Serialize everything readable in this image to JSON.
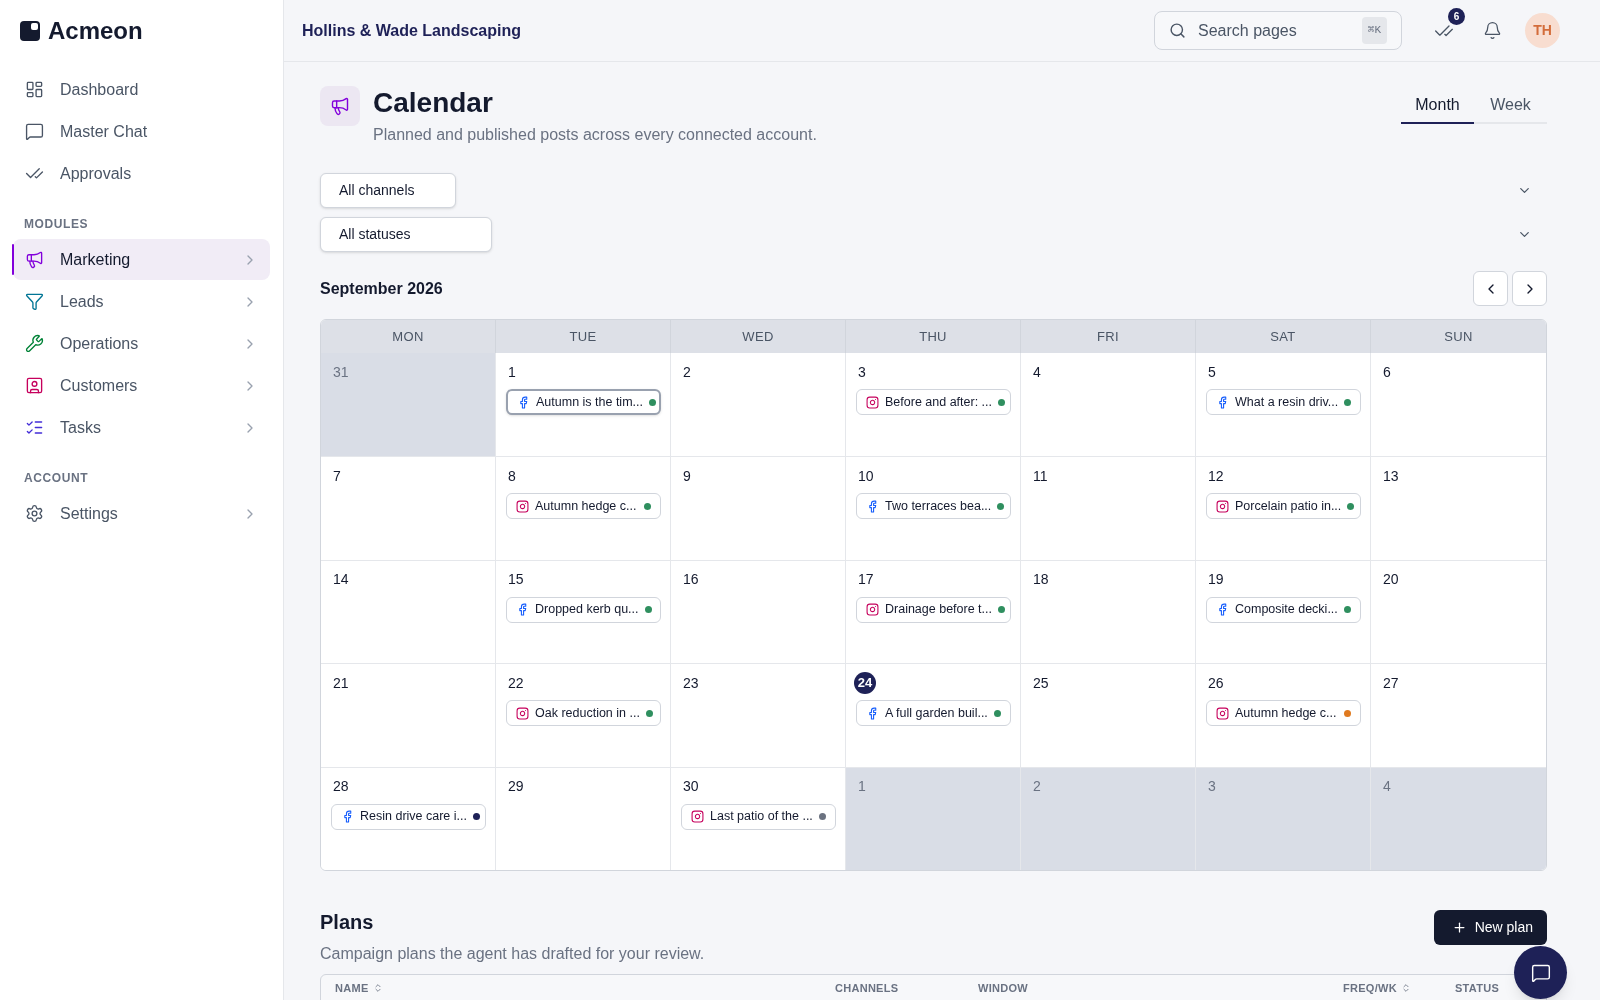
{
  "brand": "Acmeon",
  "sidebar": {
    "items": [
      {
        "label": "Dashboard",
        "selected": false,
        "expandable": false
      },
      {
        "label": "Master Chat",
        "selected": false,
        "expandable": false
      },
      {
        "label": "Approvals",
        "selected": false,
        "expandable": false
      }
    ],
    "sections": [
      {
        "heading": "MODULES",
        "items": [
          {
            "label": "Marketing",
            "selected": true,
            "expandable": true
          },
          {
            "label": "Leads",
            "selected": false,
            "expandable": true
          },
          {
            "label": "Operations",
            "selected": false,
            "expandable": true
          },
          {
            "label": "Customers",
            "selected": false,
            "expandable": true
          },
          {
            "label": "Tasks",
            "selected": false,
            "expandable": true
          }
        ]
      },
      {
        "heading": "ACCOUNT",
        "items": [
          {
            "label": "Settings",
            "selected": false,
            "expandable": true
          }
        ]
      }
    ]
  },
  "header": {
    "workspace": "Hollins & Wade Landscaping",
    "search": {
      "placeholder": "Search pages",
      "shortcut": "⌘K"
    },
    "approvals_badge": "6",
    "avatar": "TH"
  },
  "page": {
    "title": "Calendar",
    "subtitle": "Planned and published posts across every connected account."
  },
  "view_tabs": [
    {
      "label": "Month",
      "selected": true
    },
    {
      "label": "Week",
      "selected": false
    }
  ],
  "filters": [
    {
      "value": "All channels"
    },
    {
      "value": "All statuses"
    }
  ],
  "calendar": {
    "month": "September 2026",
    "weekdays": [
      "MON",
      "TUE",
      "WED",
      "THU",
      "FRI",
      "SAT",
      "SUN"
    ],
    "days": [
      {
        "date": "31",
        "outside": true,
        "today": false
      },
      {
        "date": "1",
        "outside": false,
        "today": false,
        "events": [
          {
            "kind": "facebook",
            "title": "Autumn is the tim...",
            "color": "#2f8f5f",
            "selected": true
          }
        ]
      },
      {
        "date": "2",
        "outside": false,
        "today": false
      },
      {
        "date": "3",
        "outside": false,
        "today": false,
        "events": [
          {
            "kind": "instagram",
            "title": "Before and after: ...",
            "color": "#2f8f5f",
            "selected": false
          }
        ]
      },
      {
        "date": "4",
        "outside": false,
        "today": false
      },
      {
        "date": "5",
        "outside": false,
        "today": false,
        "events": [
          {
            "kind": "facebook",
            "title": "What a resin driv...",
            "color": "#2f8f5f",
            "selected": false
          }
        ]
      },
      {
        "date": "6",
        "outside": false,
        "today": false
      },
      {
        "date": "7",
        "outside": false,
        "today": false
      },
      {
        "date": "8",
        "outside": false,
        "today": false,
        "events": [
          {
            "kind": "instagram",
            "title": "Autumn hedge c...",
            "color": "#2f8f5f",
            "selected": false
          }
        ]
      },
      {
        "date": "9",
        "outside": false,
        "today": false
      },
      {
        "date": "10",
        "outside": false,
        "today": false,
        "events": [
          {
            "kind": "facebook",
            "title": "Two terraces bea...",
            "color": "#2f8f5f",
            "selected": false
          }
        ]
      },
      {
        "date": "11",
        "outside": false,
        "today": false
      },
      {
        "date": "12",
        "outside": false,
        "today": false,
        "events": [
          {
            "kind": "instagram",
            "title": "Porcelain patio in...",
            "color": "#2f8f5f",
            "selected": false
          }
        ]
      },
      {
        "date": "13",
        "outside": false,
        "today": false
      },
      {
        "date": "14",
        "outside": false,
        "today": false
      },
      {
        "date": "15",
        "outside": false,
        "today": false,
        "events": [
          {
            "kind": "facebook",
            "title": "Dropped kerb qu...",
            "color": "#2f8f5f",
            "selected": false
          }
        ]
      },
      {
        "date": "16",
        "outside": false,
        "today": false
      },
      {
        "date": "17",
        "outside": false,
        "today": false,
        "events": [
          {
            "kind": "instagram",
            "title": "Drainage before t...",
            "color": "#2f8f5f",
            "selected": false
          }
        ]
      },
      {
        "date": "18",
        "outside": false,
        "today": false
      },
      {
        "date": "19",
        "outside": false,
        "today": false,
        "events": [
          {
            "kind": "facebook",
            "title": "Composite decki...",
            "color": "#2f8f5f",
            "selected": false
          }
        ]
      },
      {
        "date": "20",
        "outside": false,
        "today": false
      },
      {
        "date": "21",
        "outside": false,
        "today": false
      },
      {
        "date": "22",
        "outside": false,
        "today": false,
        "events": [
          {
            "kind": "instagram",
            "title": "Oak reduction in ...",
            "color": "#2f8f5f",
            "selected": false
          }
        ]
      },
      {
        "date": "23",
        "outside": false,
        "today": false
      },
      {
        "date": "24",
        "outside": false,
        "today": true,
        "events": [
          {
            "kind": "facebook",
            "title": "A full garden buil...",
            "color": "#2f8f5f",
            "selected": false
          }
        ]
      },
      {
        "date": "25",
        "outside": false,
        "today": false
      },
      {
        "date": "26",
        "outside": false,
        "today": false,
        "events": [
          {
            "kind": "instagram",
            "title": "Autumn hedge c...",
            "color": "#e07a1f",
            "selected": false
          }
        ]
      },
      {
        "date": "27",
        "outside": false,
        "today": false
      },
      {
        "date": "28",
        "outside": false,
        "today": false,
        "events": [
          {
            "kind": "facebook",
            "title": "Resin drive care i...",
            "color": "#1e2157",
            "selected": false
          }
        ]
      },
      {
        "date": "29",
        "outside": false,
        "today": false
      },
      {
        "date": "30",
        "outside": false,
        "today": false,
        "events": [
          {
            "kind": "instagram",
            "title": "Last patio of the ...",
            "color": "#6b7280",
            "selected": false
          }
        ]
      },
      {
        "date": "1",
        "outside": true,
        "today": false
      },
      {
        "date": "2",
        "outside": true,
        "today": false
      },
      {
        "date": "3",
        "outside": true,
        "today": false
      },
      {
        "date": "4",
        "outside": true,
        "today": false
      }
    ]
  },
  "plans": {
    "title": "Plans",
    "subtitle": "Campaign plans the agent has drafted for your review.",
    "new_button": "New plan",
    "table": {
      "columns": [
        {
          "label": "NAME",
          "sortable": true
        },
        {
          "label": "CHANNELS",
          "sortable": false
        },
        {
          "label": "WINDOW",
          "sortable": false
        },
        {
          "label": "FREQ/WK",
          "sortable": true
        },
        {
          "label": "STATUS",
          "sortable": false
        }
      ]
    }
  }
}
